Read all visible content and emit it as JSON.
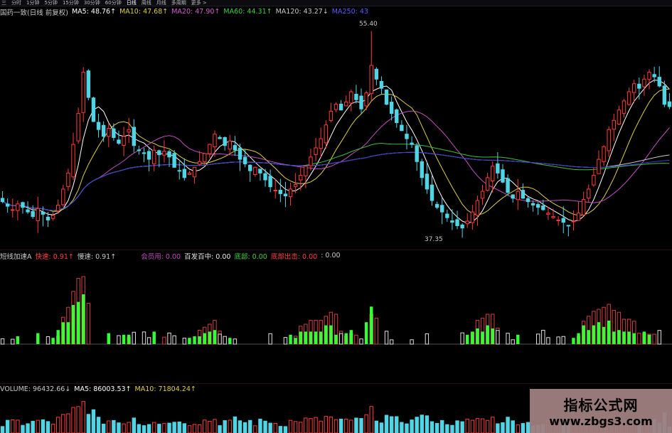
{
  "toolbar": {
    "items": [
      "三",
      "分时",
      "1分钟",
      "5分钟",
      "15分钟",
      "30分钟",
      "60分钟",
      "日线",
      "周线",
      "月线",
      "多周期",
      "更多 >"
    ],
    "active_index": 7
  },
  "main_legend": {
    "stock": "国药一致(日线 前复权)",
    "ma5": "MA5: 48.76↑",
    "ma10": "MA10: 47.68↑",
    "ma20": "MA20: 47.90↑",
    "ma60": "MA60: 44.31↑",
    "ma120": "MA120: 43.27↓",
    "ma250": "MA250: 43"
  },
  "hi_label": "55.40",
  "lo_label": "37.35",
  "indicator_legend": {
    "name": "短线加速A",
    "fast": "快速: 0.91↑",
    "slow": "慢速: 0.91↑",
    "member": "会员用: 0.00",
    "hit": "百发百中: 0.00",
    "bottom": "底部: 0.00",
    "breakout": "底部出击: 0.00",
    "extra": ": 0.00"
  },
  "volume_legend": {
    "volume": "VOLUME: 96432.66↓",
    "ma5": "MA5: 86003.53↑",
    "ma10": "MA10: 71804.24↑"
  },
  "watermark": {
    "title": "指标公式网",
    "url": "www.zbgs3.com"
  },
  "colors": {
    "up": "#ff3a3a",
    "down": "#4fd6e6",
    "ma5": "#ffffff",
    "ma10": "#e0d040",
    "ma20": "#c050c0",
    "ma60": "#3fbf3f",
    "ma120": "#c8c8c8",
    "ma250": "#3a3ad8",
    "green_bar": "#33ff33",
    "red_bar": "#d04040",
    "purple_bar": "#a040c0"
  },
  "chart_data": {
    "type": "line",
    "close": [
      40.5,
      40.1,
      39.8,
      40.3,
      40.0,
      39.6,
      39.2,
      39.9,
      39.4,
      38.9,
      39.3,
      40.2,
      41.6,
      43.0,
      45.5,
      48.2,
      51.8,
      49.6,
      47.5,
      46.8,
      46.2,
      46.9,
      46.1,
      45.6,
      46.2,
      46.8,
      45.4,
      45.0,
      44.7,
      44.2,
      45.0,
      44.6,
      44.9,
      44.4,
      43.5,
      43.2,
      42.6,
      43.0,
      43.5,
      44.0,
      44.7,
      45.5,
      46.4,
      46.0,
      45.4,
      45.8,
      45.0,
      44.2,
      43.8,
      43.2,
      43.5,
      43.0,
      42.4,
      41.8,
      41.5,
      41.2,
      41.0,
      41.6,
      42.0,
      42.8,
      43.6,
      44.4,
      45.2,
      46.0,
      47.2,
      48.4,
      49.0,
      48.5,
      49.2,
      50.1,
      49.4,
      48.6,
      50.0,
      52.4,
      51.2,
      50.4,
      49.0,
      48.2,
      47.4,
      46.7,
      46.0,
      45.5,
      44.0,
      42.6,
      41.6,
      40.6,
      40.0,
      39.6,
      39.1,
      38.7,
      38.4,
      38.2,
      38.8,
      39.6,
      40.6,
      41.4,
      42.6,
      43.6,
      43.0,
      42.2,
      41.3,
      40.8,
      41.4,
      40.8,
      40.5,
      40.2,
      40.0,
      39.8,
      39.5,
      39.2,
      38.9,
      38.7,
      38.4,
      38.8,
      39.5,
      40.7,
      41.6,
      42.8,
      44.2,
      45.3,
      46.8,
      47.6,
      48.5,
      49.3,
      50.1,
      50.8,
      50.4,
      51.2,
      51.8,
      51.4,
      50.6,
      49.0,
      48.8
    ],
    "ma_series": [
      "MA5",
      "MA10",
      "MA20",
      "MA60",
      "MA120",
      "MA250"
    ],
    "ylim": [
      37,
      56
    ],
    "hi": 55.4,
    "lo": 37.35
  }
}
